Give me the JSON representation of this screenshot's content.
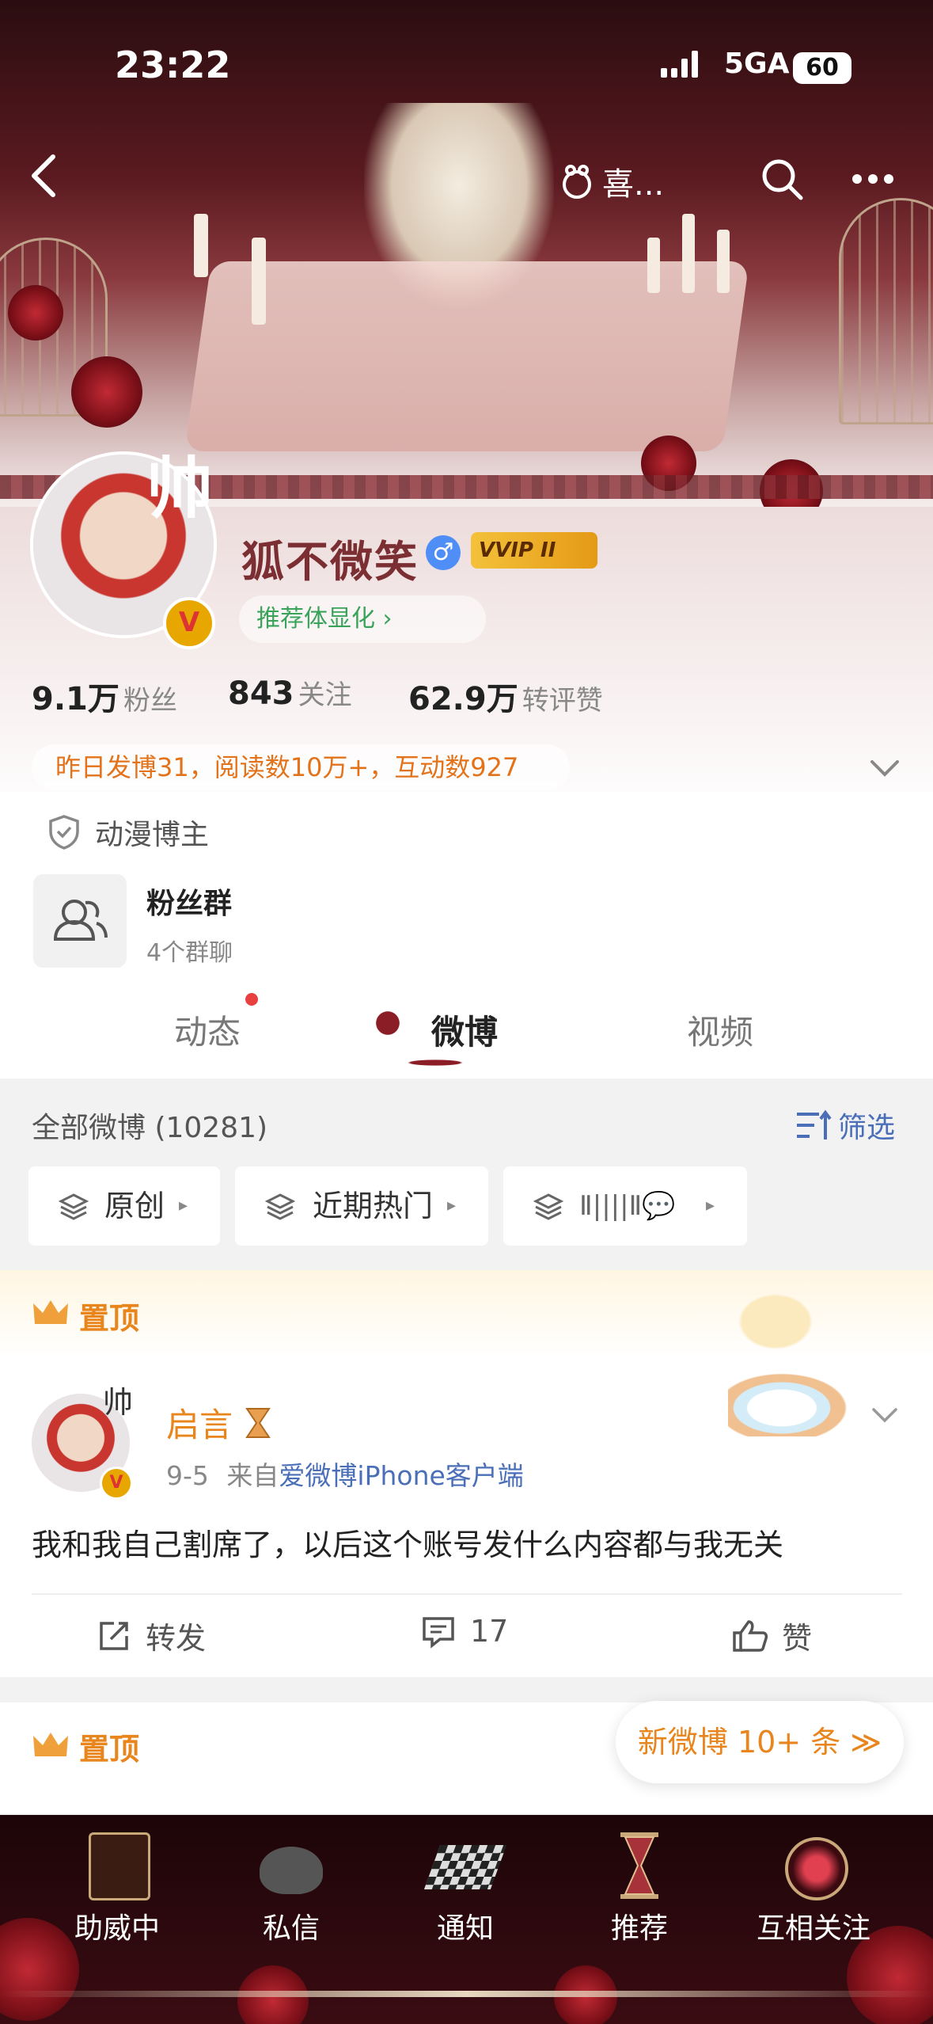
{
  "status_bar": {
    "time": "23:22",
    "network": "5GA",
    "battery": "60"
  },
  "top_nav": {
    "title": "喜..."
  },
  "profile": {
    "avatar_tag": "帅",
    "name": "狐不微笑",
    "vip_badge": "VVIP II",
    "recommend": "推荐体显化 ›",
    "stats": [
      {
        "value": "9.1万",
        "label": "粉丝"
      },
      {
        "value": "843",
        "label": "关注"
      },
      {
        "value": "62.9万",
        "label": "转评赞"
      }
    ],
    "notice": "昨日发博31，阅读数10万+，互动数927",
    "category": "动漫博主",
    "fan_group": {
      "title": "粉丝群",
      "subtitle": "4个群聊"
    }
  },
  "tabs": [
    {
      "label": "动态"
    },
    {
      "label": "微博"
    },
    {
      "label": "视频"
    }
  ],
  "feed": {
    "all_count": "全部微博 (10281)",
    "filter": "筛选",
    "chips": [
      "原创",
      "近期热门",
      "Ⅱ||||Ⅱ💬"
    ]
  },
  "pinned_label": "置顶",
  "post": {
    "author": "启言",
    "date": "9-5",
    "source_prefix": "来自",
    "source": "爱微博iPhone客户端",
    "text": "我和我自己割席了，以后这个账号发什么内容都与我无关",
    "actions": {
      "repost": "转发",
      "comments": "17",
      "like": "赞"
    }
  },
  "new_posts": "新微博 10+ 条 ≫",
  "bottom_nav": [
    {
      "label": "助威中"
    },
    {
      "label": "私信"
    },
    {
      "label": "通知"
    },
    {
      "label": "推荐"
    },
    {
      "label": "互相关注"
    }
  ]
}
